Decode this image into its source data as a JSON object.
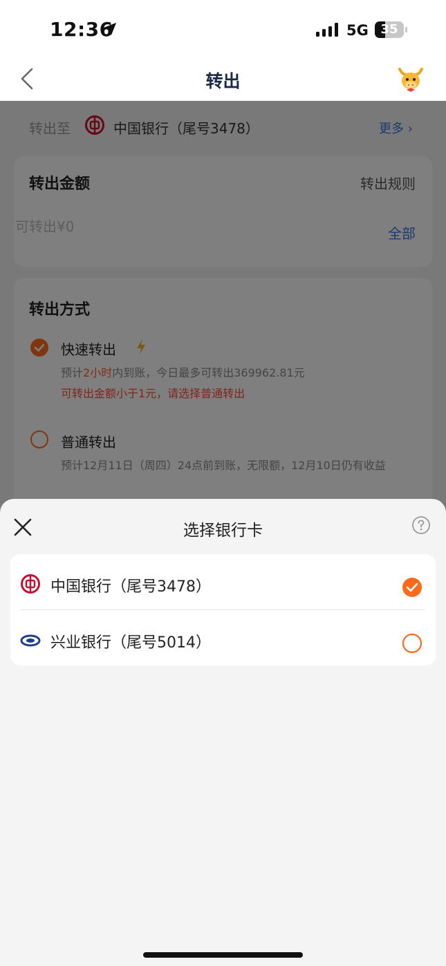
{
  "status_bar": {
    "time": "12:36",
    "network": "5G",
    "battery": "35"
  },
  "nav": {
    "title": "转出",
    "back_icon": "chevron-left-icon",
    "mascot_icon": "cow-mascot-icon"
  },
  "transfer_to": {
    "label": "转出至",
    "bank": "中国银行（尾号3478）",
    "more": "更多"
  },
  "amount_card": {
    "title": "转出金额",
    "rules": "转出规则",
    "placeholder": "可转出¥0",
    "all": "全部"
  },
  "method_card": {
    "title": "转出方式",
    "fast": {
      "name": "快速转出",
      "desc_prefix": "预计",
      "desc_highlight": "2小时",
      "desc_suffix": "内到账，今日最多可转出369962.81元",
      "warning": "可转出金额小于1元，请选择普通转出"
    },
    "normal": {
      "name": "普通转出",
      "desc": "预计12月11日（周四）24点前到账，无限额，12月10日仍有收益"
    }
  },
  "sheet": {
    "title": "选择银行卡",
    "banks": [
      {
        "name": "中国银行（尾号3478）",
        "selected": true,
        "icon": "boc-logo-icon"
      },
      {
        "name": "兴业银行（尾号5014）",
        "selected": false,
        "icon": "cib-logo-icon"
      }
    ]
  },
  "colors": {
    "accent": "#ff6a1a",
    "link": "#3a76d8",
    "boc_red": "#c8102e",
    "cib_blue": "#1b3f8b"
  }
}
